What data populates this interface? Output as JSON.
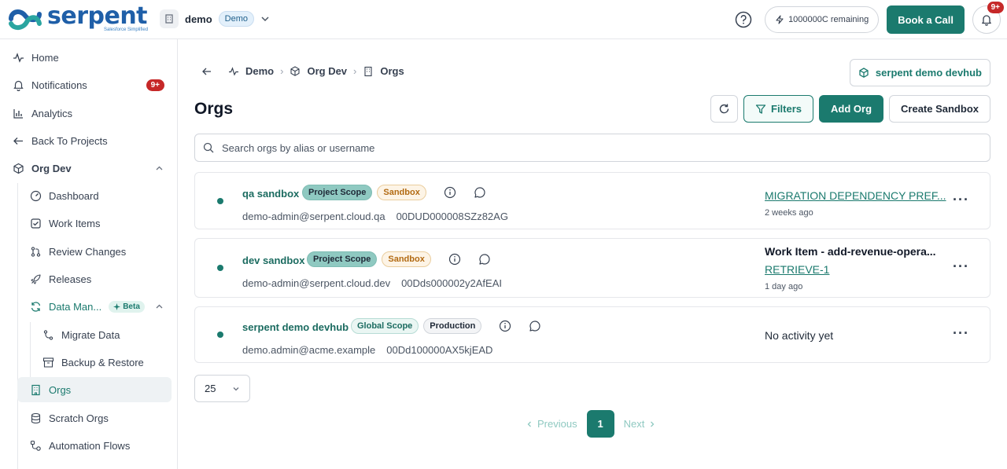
{
  "brand": {
    "name": "serpent",
    "tagline": "Salesforce Simplified"
  },
  "workspace": {
    "name": "demo",
    "badge": "Demo"
  },
  "topbar": {
    "credits": "1000000C remaining",
    "book_call": "Book a Call",
    "notif_badge": "9+"
  },
  "sidebar": {
    "items": [
      {
        "label": "Home"
      },
      {
        "label": "Notifications",
        "badge": "9+"
      },
      {
        "label": "Analytics"
      },
      {
        "label": "Back To Projects"
      },
      {
        "label": "Org Dev"
      },
      {
        "label": "Dashboard"
      },
      {
        "label": "Work Items"
      },
      {
        "label": "Review Changes"
      },
      {
        "label": "Releases"
      },
      {
        "label": "Data Man...",
        "badge": "Beta"
      },
      {
        "label": "Migrate Data"
      },
      {
        "label": "Backup & Restore"
      },
      {
        "label": "Orgs"
      },
      {
        "label": "Scratch Orgs"
      },
      {
        "label": "Automation Flows"
      }
    ]
  },
  "breadcrumb": {
    "items": [
      "Demo",
      "Org Dev",
      "Orgs"
    ]
  },
  "devhub_button": "serpent demo devhub",
  "page": {
    "title": "Orgs",
    "filters": "Filters",
    "add_org": "Add Org",
    "create_sandbox": "Create Sandbox",
    "search_placeholder": "Search orgs by alias or username"
  },
  "orgs": [
    {
      "name": "qa sandbox",
      "scope": "Project Scope",
      "type": "Sandbox",
      "username": "demo-admin@serpent.cloud.qa",
      "org_id": "00DUD000008SZz82AG",
      "activity_link": "MIGRATION DEPENDENCY PREF...",
      "activity_time": "2 weeks ago"
    },
    {
      "name": "dev sandbox",
      "scope": "Project Scope",
      "type": "Sandbox",
      "username": "demo-admin@serpent.cloud.dev",
      "org_id": "00Dds000002y2AfEAI",
      "activity_title": "Work Item - add-revenue-opera...",
      "activity_link": "RETRIEVE-1",
      "activity_time": "1 day ago"
    },
    {
      "name": "serpent demo devhub",
      "scope": "Global Scope",
      "type": "Production",
      "username": "demo.admin@acme.example",
      "org_id": "00Dd100000AX5kjEAD",
      "activity_text": "No activity yet"
    }
  ],
  "pagination": {
    "per_page": "25",
    "previous": "Previous",
    "current": "1",
    "next": "Next"
  }
}
